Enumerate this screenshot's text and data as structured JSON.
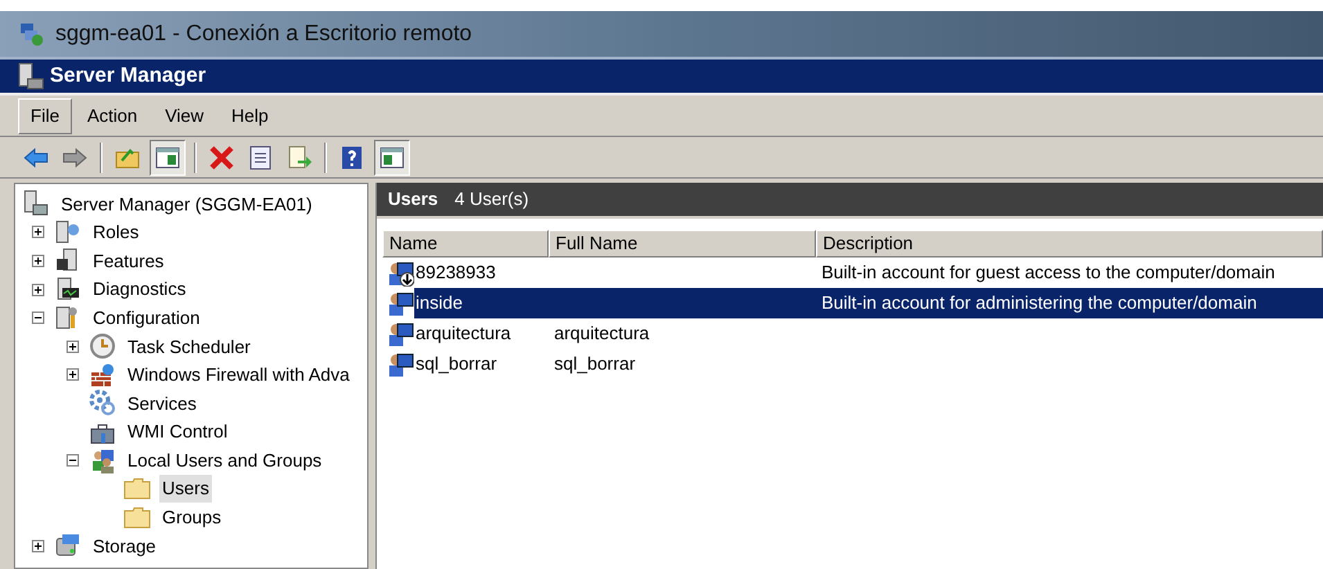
{
  "rdp_window": {
    "title": "sggm-ea01 - Conexión a Escritorio remoto"
  },
  "window": {
    "title": "Server Manager"
  },
  "menu": [
    {
      "label": "File",
      "selected": true
    },
    {
      "label": "Action",
      "selected": false
    },
    {
      "label": "View",
      "selected": false
    },
    {
      "label": "Help",
      "selected": false
    }
  ],
  "toolbar_toggles": [
    {
      "on": true
    },
    {
      "on": true
    }
  ],
  "tree": [
    {
      "label": "Server Manager (SGGM-EA01)",
      "selected": false,
      "children": [
        {
          "label": "Roles",
          "expanded": false,
          "selected": false
        },
        {
          "label": "Features",
          "expanded": false,
          "selected": false
        },
        {
          "label": "Diagnostics",
          "expanded": false,
          "selected": false
        },
        {
          "label": "Configuration",
          "expanded": true,
          "selected": false,
          "children": [
            {
              "label": "Task Scheduler",
              "expanded": false,
              "selected": false
            },
            {
              "label": "Windows Firewall with Adva",
              "expanded": false,
              "selected": false
            },
            {
              "label": "Services",
              "selected": false
            },
            {
              "label": "WMI Control",
              "selected": false
            },
            {
              "label": "Local Users and Groups",
              "expanded": true,
              "selected": false,
              "children": [
                {
                  "label": "Users",
                  "selected": true
                },
                {
                  "label": "Groups",
                  "selected": false
                }
              ]
            }
          ]
        },
        {
          "label": "Storage",
          "expanded": false,
          "selected": false
        }
      ]
    }
  ],
  "panel": {
    "title": "Users",
    "count": "4 User(s)"
  },
  "table": {
    "columns": [
      "Name",
      "Full Name",
      "Description"
    ],
    "rows": [
      {
        "cells": [
          "89238933",
          "",
          "Built-in account for guest access to the computer/domain"
        ],
        "disabled": true,
        "selected": false
      },
      {
        "cells": [
          "inside",
          "",
          "Built-in account for administering the computer/domain"
        ],
        "disabled": false,
        "selected": true
      },
      {
        "cells": [
          "arquitectura",
          "arquitectura",
          ""
        ],
        "disabled": false,
        "selected": false
      },
      {
        "cells": [
          "sql_borrar",
          "sql_borrar",
          ""
        ],
        "disabled": false,
        "selected": false
      }
    ]
  }
}
